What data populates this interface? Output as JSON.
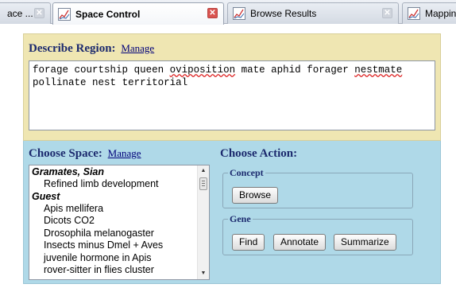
{
  "tabs": [
    {
      "label": "ace ...",
      "close": "grey",
      "active": false
    },
    {
      "label": "Space Control",
      "close": "red",
      "active": true
    },
    {
      "label": "Browse Results",
      "close": "grey",
      "active": false
    },
    {
      "label": "Mappin",
      "close": "",
      "active": false
    }
  ],
  "describe": {
    "title": "Describe Region:",
    "manage_label": "Manage",
    "text_words": [
      "forage",
      "courtship",
      "queen",
      "oviposition",
      "mate",
      "aphid",
      "forager",
      "nestmate",
      "pollinate",
      "nest",
      "territorial"
    ]
  },
  "space": {
    "title": "Choose Space:",
    "manage_label": "Manage",
    "groups": [
      {
        "name": "Gramates, Sian",
        "items": [
          "Refined limb development"
        ]
      },
      {
        "name": "Guest",
        "items": [
          "Apis mellifera",
          "Dicots CO2",
          "Drosophila melanogaster",
          "Insects minus Dmel + Aves",
          "juvenile hormone in Apis",
          "rover-sitter in flies cluster"
        ]
      }
    ]
  },
  "action": {
    "title": "Choose Action:",
    "concept_legend": "Concept",
    "browse_label": "Browse",
    "gene_legend": "Gene",
    "find_label": "Find",
    "annotate_label": "Annotate",
    "summarize_label": "Summarize"
  },
  "colors": {
    "describe_bg": "#efe6b2",
    "choose_bg": "#afd9e8",
    "title_color": "#1c2a6e",
    "spellcheck_underline": "#dd2222"
  },
  "icons": {
    "tab_favicon": "chart-icon",
    "tab_close": "close-icon",
    "scroll_up": "arrow-up-icon",
    "scroll_down": "arrow-down-icon"
  }
}
